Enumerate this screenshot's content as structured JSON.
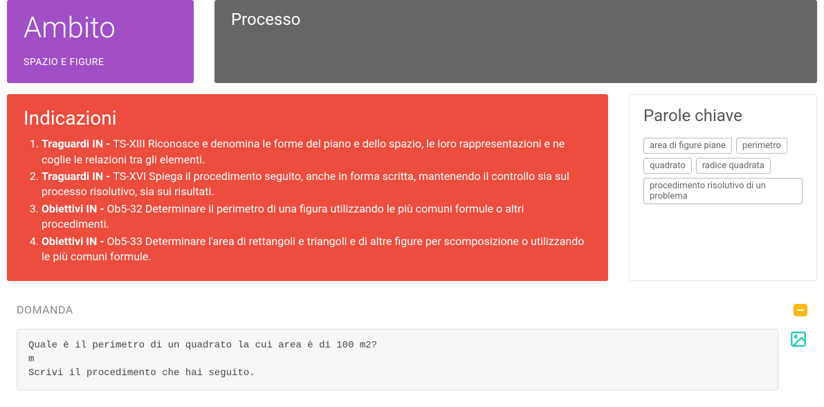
{
  "ambito": {
    "title": "Ambito",
    "subtitle": "SPAZIO E FIGURE"
  },
  "processo": {
    "title": "Processo"
  },
  "indicazioni": {
    "title": "Indicazioni",
    "items": [
      {
        "prefix": "Traguardi IN - ",
        "text": "TS-XIII Riconosce e denomina le forme del piano e dello spazio, le loro rappresentazioni e ne coglie le relazioni tra gli elementi."
      },
      {
        "prefix": "Traguardi IN - ",
        "text": "TS-XVI Spiega il procedimento seguito, anche in forma scritta, mantenendo il controllo sia sul processo risolutivo, sia sui risultati."
      },
      {
        "prefix": "Obiettivi IN - ",
        "text": "Ob5-32 Determinare il perimetro di una figura utilizzando le più comuni formule o altri procedimenti."
      },
      {
        "prefix": "Obiettivi IN - ",
        "text": "Ob5-33 Determinare l'area di rettangoli e triangoli e di altre figure per scomposizione o utilizzando le più comuni formule."
      }
    ]
  },
  "parole": {
    "title": "Parole chiave",
    "tags": [
      "area di figure piane",
      "perimetro",
      "quadrato",
      "radice quadrata",
      "procedimento risolutivo di un problema"
    ]
  },
  "domanda": {
    "title": "DOMANDA",
    "question": "Quale è il perimetro di un quadrato la cui area è di 100 m2?\nm\nScrivi il procedimento che hai seguito."
  }
}
